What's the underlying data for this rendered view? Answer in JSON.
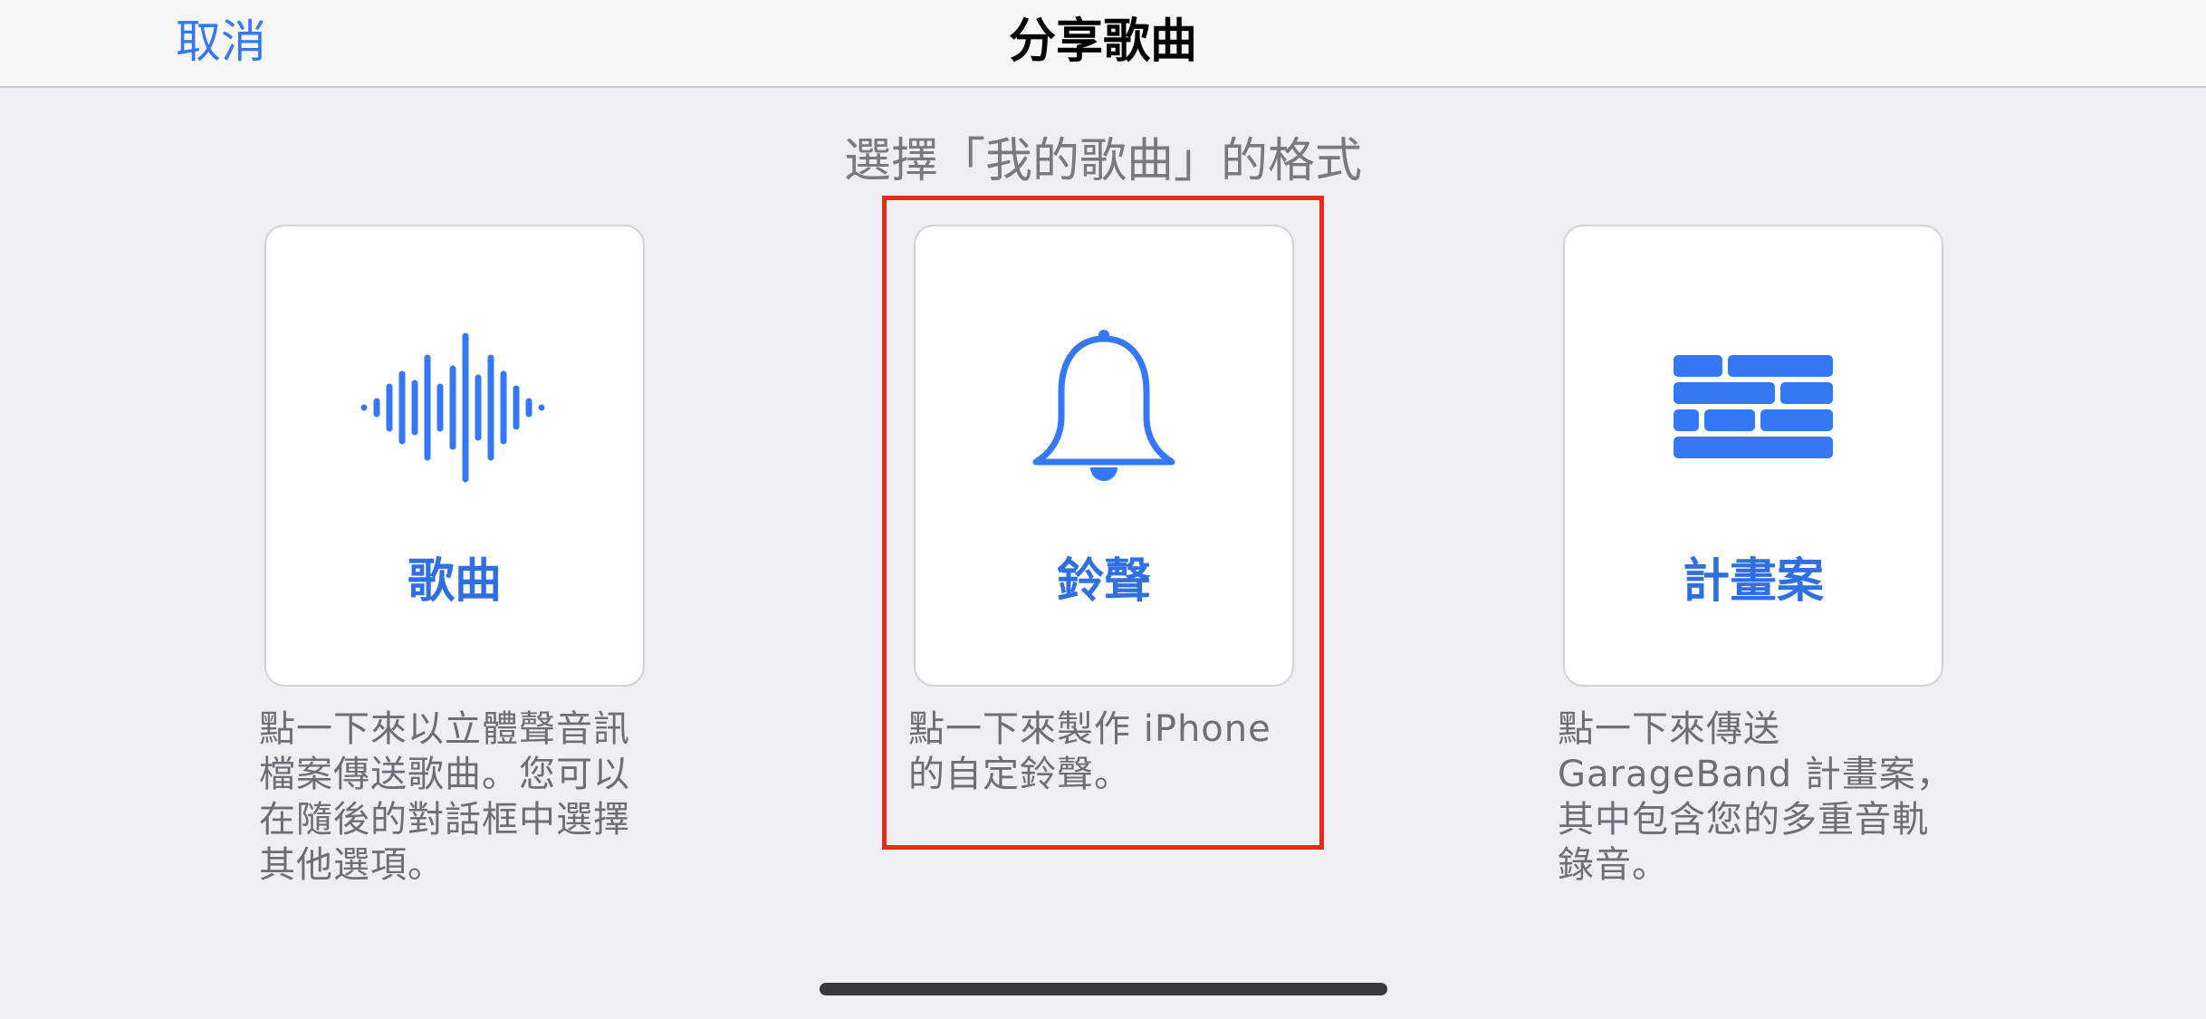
{
  "navbar": {
    "cancel_label": "取消",
    "title": "分享歌曲"
  },
  "subtitle": "選擇「我的歌曲」的格式",
  "options": [
    {
      "icon": "waveform-icon",
      "label": "歌曲",
      "description": "點一下來以立體聲音訊檔案傳送歌曲。您可以在隨後的對話框中選擇其他選項。"
    },
    {
      "icon": "bell-icon",
      "label": "鈴聲",
      "description": "點一下來製作 iPhone 的自定鈴聲。"
    },
    {
      "icon": "brick-wall-icon",
      "label": "計畫案",
      "description": "點一下來傳送 GarageBand 計畫案，其中包含您的多重音軌錄音。"
    }
  ],
  "colors": {
    "accent": "#3478F6",
    "highlight": "#E8291C",
    "background": "#EFEEF3"
  }
}
